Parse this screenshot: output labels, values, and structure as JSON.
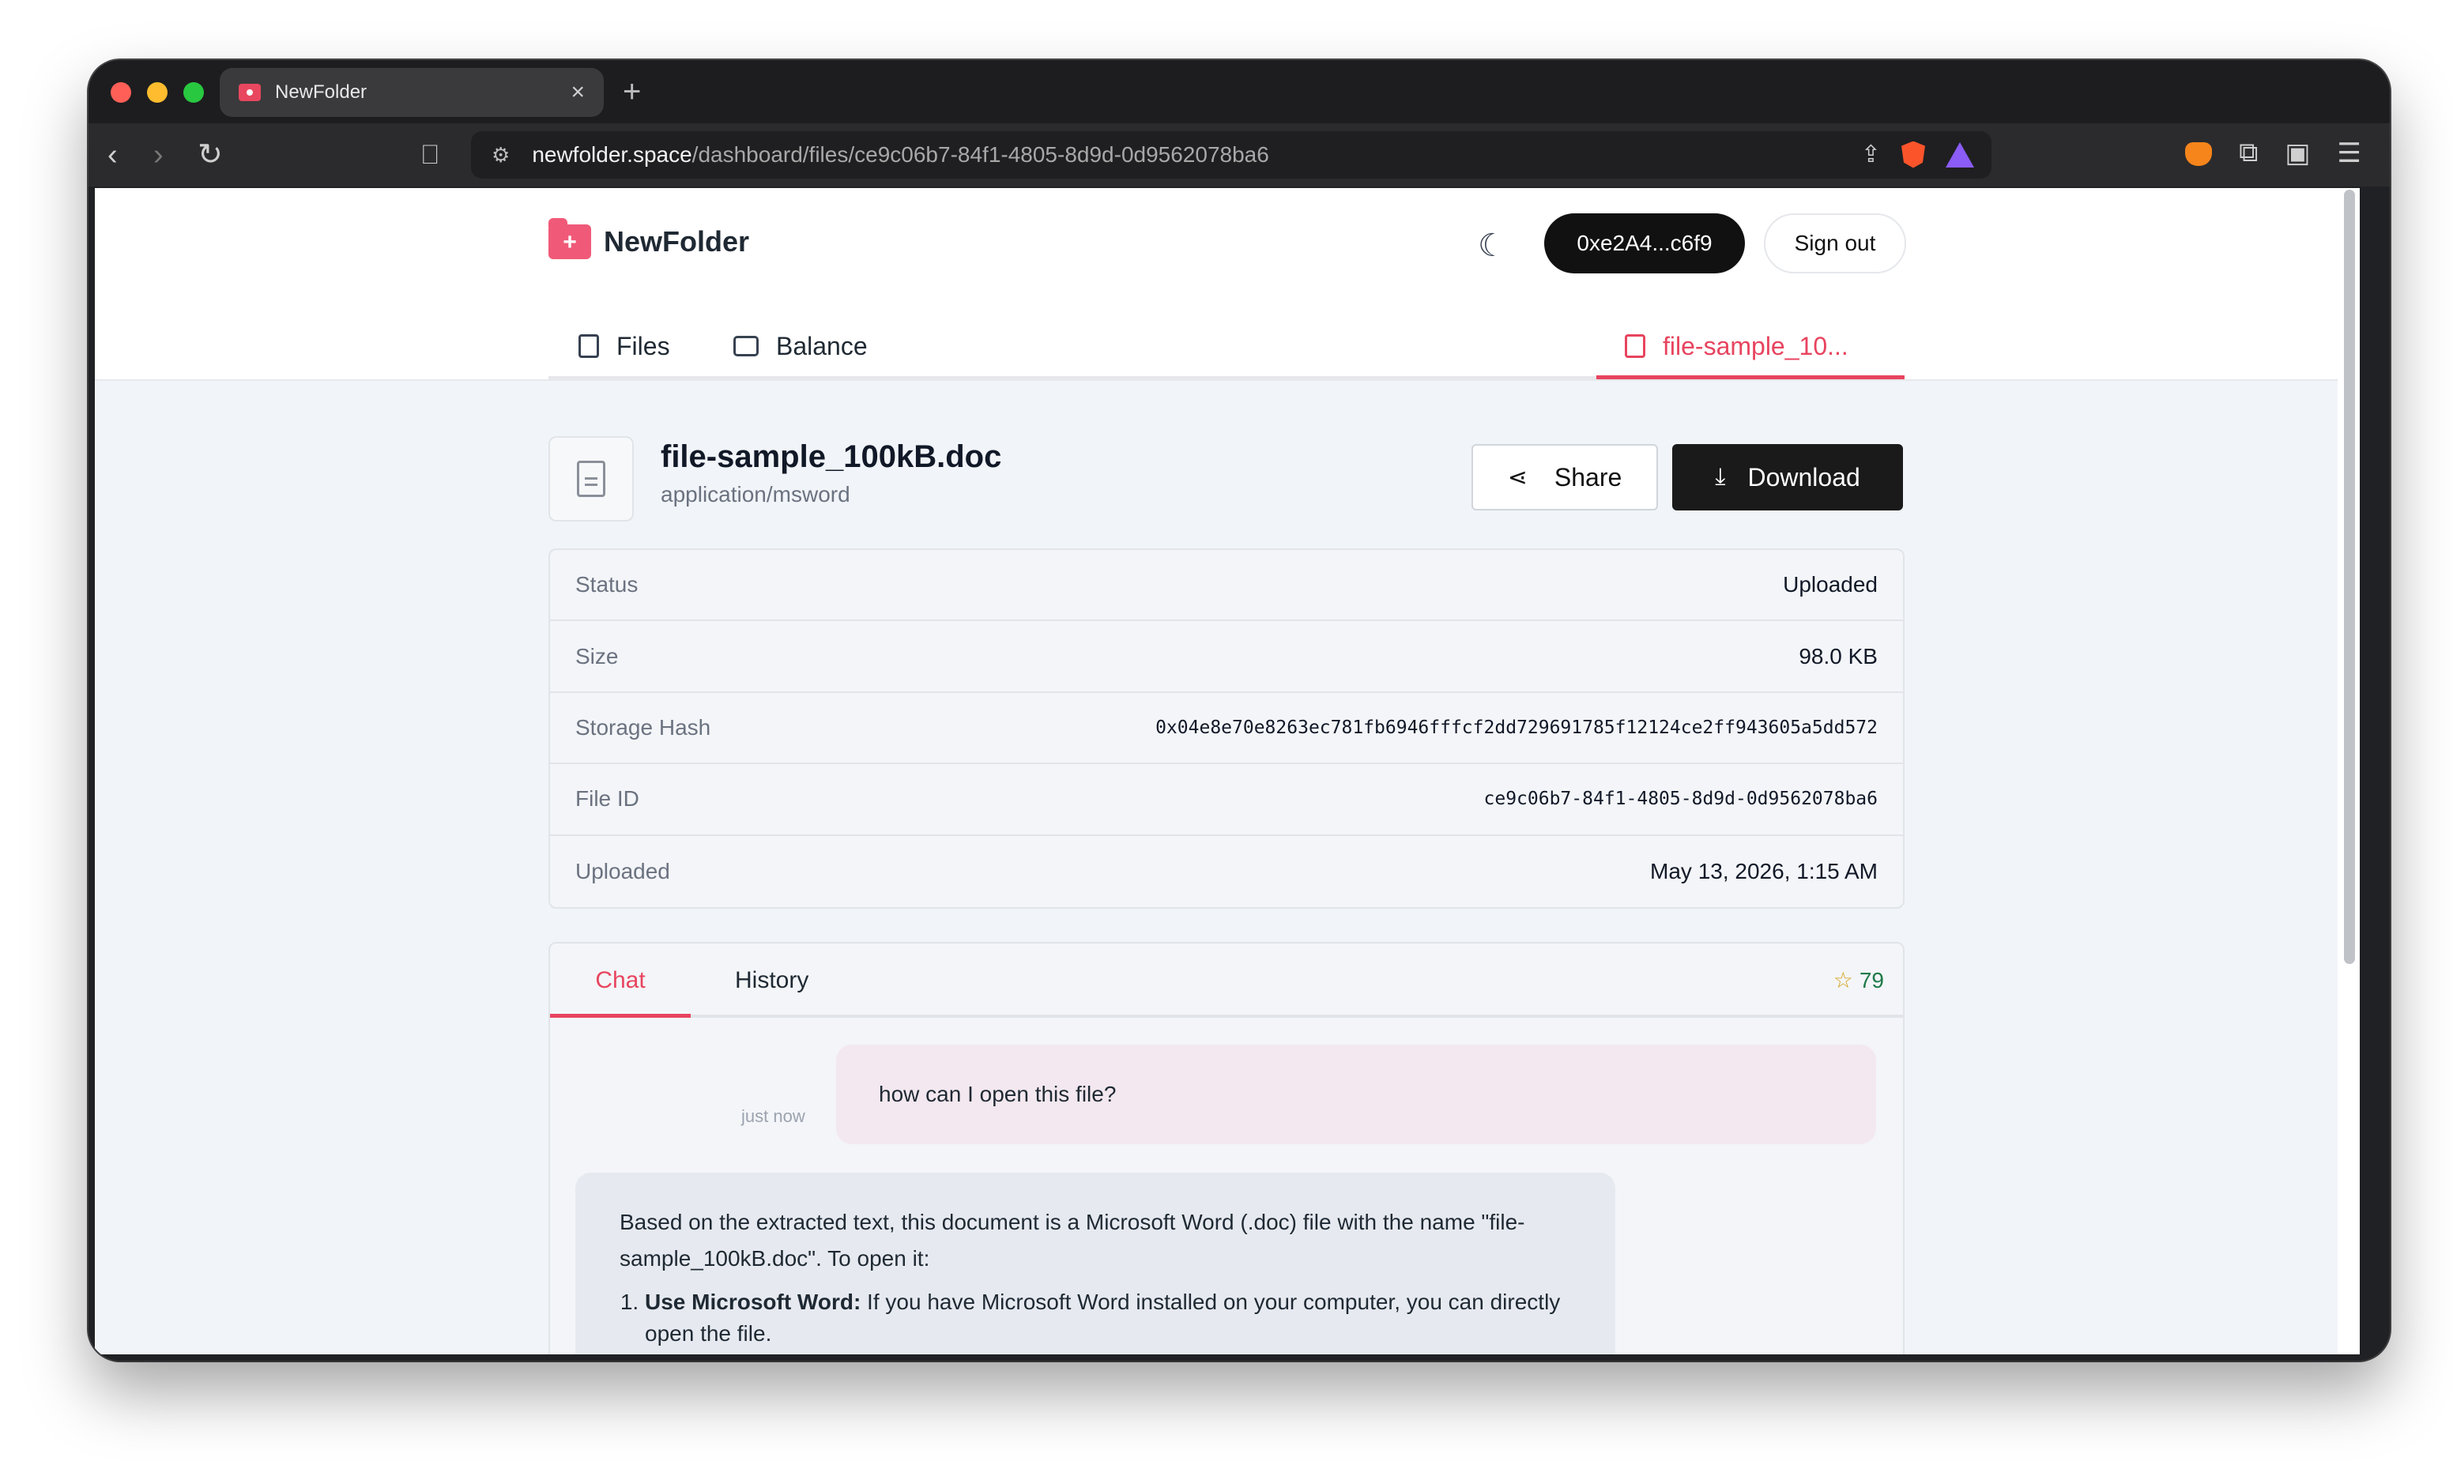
{
  "browser": {
    "tab_title": "NewFolder",
    "tab_close": "×",
    "new_tab": "+",
    "url_host": "newfolder.space",
    "url_path": "/dashboard/files/ce9c06b7-84f1-4805-8d9d-0d9562078ba6"
  },
  "header": {
    "brand": "NewFolder",
    "wallet_label": "0xe2A4...c6f9",
    "signout_label": "Sign out"
  },
  "nav": {
    "files": "Files",
    "balance": "Balance",
    "file_tab": "file-sample_10..."
  },
  "file": {
    "name": "file-sample_100kB.doc",
    "mime": "application/msword",
    "share_label": "Share",
    "download_label": "Download"
  },
  "details": [
    {
      "label": "Status",
      "value": "Uploaded",
      "mono": false
    },
    {
      "label": "Size",
      "value": "98.0 KB",
      "mono": false
    },
    {
      "label": "Storage Hash",
      "value": "0x04e8e70e8263ec781fb6946fffcf2dd729691785f12124ce2ff943605a5dd572",
      "mono": true
    },
    {
      "label": "File ID",
      "value": "ce9c06b7-84f1-4805-8d9d-0d9562078ba6",
      "mono": true
    },
    {
      "label": "Uploaded",
      "value": "May 13, 2026, 1:15 AM",
      "mono": false
    }
  ],
  "chat": {
    "tab_chat": "Chat",
    "tab_history": "History",
    "stars": "79",
    "user_time": "just now",
    "user_message": "how can I open this file?",
    "bot_intro": "Based on the extracted text, this document is a Microsoft Word (.doc) file with the name \"file-sample_100kB.doc\". To open it:",
    "bot_item1_title": "Use Microsoft Word:",
    "bot_item1_text": " If you have Microsoft Word installed on your computer, you can directly open the file."
  }
}
